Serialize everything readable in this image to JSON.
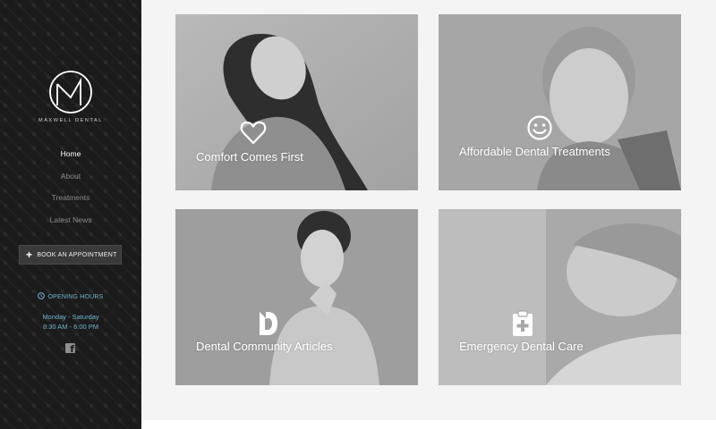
{
  "sidebar": {
    "brand": "MAXWELL DENTAL",
    "nav": [
      {
        "label": "Home",
        "active": true
      },
      {
        "label": "About",
        "active": false
      },
      {
        "label": "Treatments",
        "active": false
      },
      {
        "label": "Latest News",
        "active": false
      }
    ],
    "book_button": "BOOK AN APPOINTMENT",
    "hours_heading": "OPENING HOURS",
    "hours_days": "Monday - Saturday",
    "hours_time": "8:30 AM - 6:00 PM",
    "social_icon": "facebook-icon"
  },
  "cards": [
    {
      "title": "Comfort Comes First",
      "icon": "heart-icon"
    },
    {
      "title": "Affordable Dental Treatments",
      "icon": "smile-icon"
    },
    {
      "title": "Dental Community Articles",
      "icon": "d-logo-icon"
    },
    {
      "title": "Emergency Dental Care",
      "icon": "medical-clipboard-icon"
    }
  ],
  "colors": {
    "sidebar_bg": "#1b1b1b",
    "accent": "#6fb6d0",
    "page_bg": "#f4f4f4"
  }
}
